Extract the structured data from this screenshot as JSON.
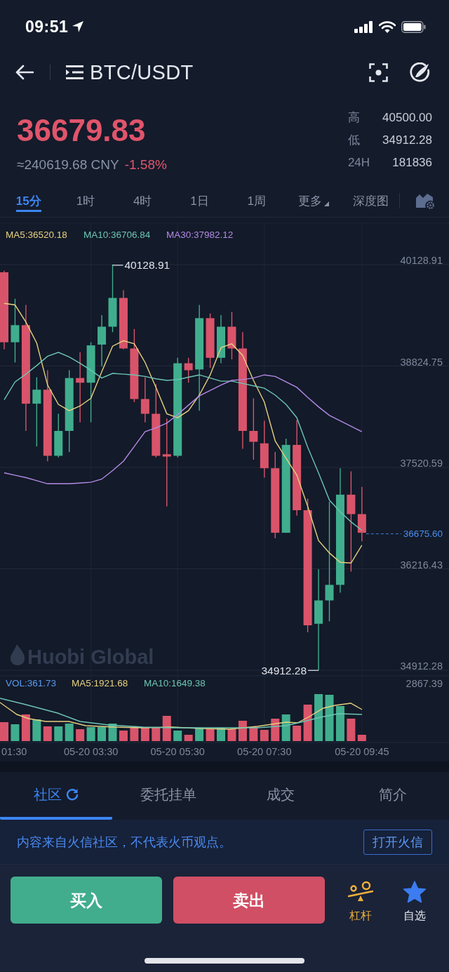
{
  "status_bar": {
    "time": "09:51"
  },
  "header": {
    "title": "BTC/USDT"
  },
  "ticker": {
    "price": "36679.83",
    "cny": "≈240619.68 CNY",
    "change": "-1.58%",
    "stats": [
      {
        "label": "高",
        "value": "40500.00"
      },
      {
        "label": "低",
        "value": "34912.28"
      },
      {
        "label": "24H",
        "value": "181836"
      }
    ]
  },
  "interval_tabs": [
    {
      "label": "15分",
      "selected": true,
      "kind": "plain"
    },
    {
      "label": "1时",
      "selected": false,
      "kind": "plain"
    },
    {
      "label": "4时",
      "selected": false,
      "kind": "plain"
    },
    {
      "label": "1日",
      "selected": false,
      "kind": "plain"
    },
    {
      "label": "1周",
      "selected": false,
      "kind": "plain"
    },
    {
      "label": "更多",
      "selected": false,
      "kind": "menu"
    },
    {
      "label": "深度图",
      "selected": false,
      "kind": "plain"
    }
  ],
  "chart": {
    "chart_data": {
      "type": "candlestick",
      "grid": true,
      "categories": [
        null,
        null,
        null,
        null,
        null,
        null,
        null,
        null,
        "05-20 03:30",
        null,
        null,
        null,
        null,
        null,
        null,
        null,
        "05-20 05:30",
        null,
        null,
        null,
        null,
        null,
        null,
        null,
        "05-20 07:30",
        null,
        null,
        null,
        null,
        null,
        null,
        null,
        null,
        "05-20 09:45"
      ],
      "ohlc": [
        [
          40030,
          40050,
          39040,
          39130
        ],
        [
          39130,
          39690,
          38870,
          39350
        ],
        [
          39350,
          39610,
          37990,
          38340
        ],
        [
          38340,
          38680,
          37790,
          38520
        ],
        [
          38520,
          38770,
          37600,
          37670
        ],
        [
          37670,
          38210,
          37650,
          37990
        ],
        [
          37990,
          38770,
          37720,
          38670
        ],
        [
          38670,
          39000,
          38100,
          38610
        ],
        [
          38610,
          39130,
          38100,
          39090
        ],
        [
          39100,
          39480,
          38820,
          39330
        ],
        [
          39330,
          40130,
          39260,
          39700
        ],
        [
          39700,
          39800,
          39040,
          39050
        ],
        [
          39050,
          39300,
          38360,
          38400
        ],
        [
          38400,
          38680,
          38100,
          38210
        ],
        [
          38210,
          38590,
          37650,
          37670
        ],
        [
          37690,
          38150,
          37020,
          37660
        ],
        [
          37670,
          38930,
          37650,
          38860
        ],
        [
          38860,
          38930,
          38610,
          38770
        ],
        [
          38780,
          39610,
          38250,
          39440
        ],
        [
          39440,
          39500,
          38800,
          38930
        ],
        [
          38930,
          39480,
          38860,
          39330
        ],
        [
          39330,
          39520,
          38910,
          39050
        ],
        [
          39050,
          39260,
          37760,
          37990
        ],
        [
          37990,
          38410,
          37620,
          37850
        ],
        [
          37830,
          38120,
          37390,
          37510
        ],
        [
          37510,
          37720,
          36610,
          36680
        ],
        [
          36680,
          37890,
          36680,
          37810
        ],
        [
          37810,
          38130,
          36900,
          36970
        ],
        [
          36970,
          37120,
          35400,
          35490
        ],
        [
          35510,
          36210,
          34910,
          35810
        ],
        [
          35810,
          37080,
          35540,
          36010
        ],
        [
          36010,
          37510,
          35910,
          37170
        ],
        [
          37170,
          37470,
          36180,
          36920
        ],
        [
          36920,
          37270,
          36570,
          36680
        ]
      ],
      "ylim": [
        34912.28,
        40128.91
      ],
      "yticks": [
        {
          "value": 40128.91,
          "label": "40128.91"
        },
        {
          "value": 38824.75,
          "label": "38824.75"
        },
        {
          "value": 37520.59,
          "label": "37520.59"
        },
        {
          "value": 36216.43,
          "label": "36216.43"
        },
        {
          "value": 34912.28,
          "label": "34912.28"
        }
      ],
      "series": [
        {
          "name": "MA5:36520.18",
          "type": "line",
          "color": "#e6d07f",
          "values": [
            39630,
            39610,
            39390,
            39120,
            38580,
            38330,
            38250,
            38310,
            38410,
            38750,
            39080,
            39150,
            39110,
            38870,
            38550,
            38210,
            38160,
            38250,
            38450,
            38710,
            39060,
            39110,
            38960,
            38640,
            38360,
            37860,
            37640,
            37420,
            37020,
            36580,
            36420,
            36300,
            36290,
            36520
          ]
        },
        {
          "name": "MA10:36706.84",
          "type": "line",
          "color": "#6cc5b4",
          "values": [
            38390,
            38620,
            38720,
            38830,
            38950,
            39000,
            38940,
            38860,
            38770,
            38670,
            38730,
            38720,
            38710,
            38690,
            38660,
            38640,
            38650,
            38680,
            38710,
            38670,
            38630,
            38630,
            38600,
            38570,
            38540,
            38450,
            38330,
            38160,
            37780,
            37450,
            37100,
            36950,
            36820,
            36710
          ]
        },
        {
          "name": "MA30:37982.12",
          "type": "line",
          "color": "#b48ae6",
          "values": [
            37450,
            37420,
            37390,
            37350,
            37310,
            37310,
            37310,
            37320,
            37330,
            37370,
            37480,
            37600,
            37790,
            37980,
            38030,
            38090,
            38200,
            38320,
            38440,
            38510,
            38580,
            38640,
            38650,
            38670,
            38710,
            38690,
            38620,
            38550,
            38420,
            38300,
            38190,
            38120,
            38050,
            37980
          ]
        }
      ]
    },
    "edge_time_label": "01:30",
    "high_marker": "40128.91",
    "low_marker": "34912.28",
    "last_price": "36675.60",
    "watermark": "Huobi Global"
  },
  "volume": {
    "legend": [
      {
        "label": "VOL:361.73",
        "color": "#5a9bf0"
      },
      {
        "label": "MA5:1921.68",
        "color": "#e6d07f"
      },
      {
        "label": "MA10:1649.38",
        "color": "#6cc5b4"
      }
    ],
    "max_tick": "2867.39"
  },
  "info_tabs": [
    {
      "label": "社区",
      "selected": true,
      "kind": "refresh"
    },
    {
      "label": "委托挂单",
      "selected": false,
      "kind": "plain"
    },
    {
      "label": "成交",
      "selected": false,
      "kind": "plain"
    },
    {
      "label": "简介",
      "selected": false,
      "kind": "plain"
    }
  ],
  "notice": {
    "text": "内容来自火信社区，不代表火币观点。",
    "button": "打开火信"
  },
  "actions": {
    "buy": "买入",
    "sell": "卖出",
    "tools": [
      {
        "label": "杠杆",
        "kind": "leverage"
      },
      {
        "label": "自选",
        "kind": "favorite"
      }
    ]
  }
}
